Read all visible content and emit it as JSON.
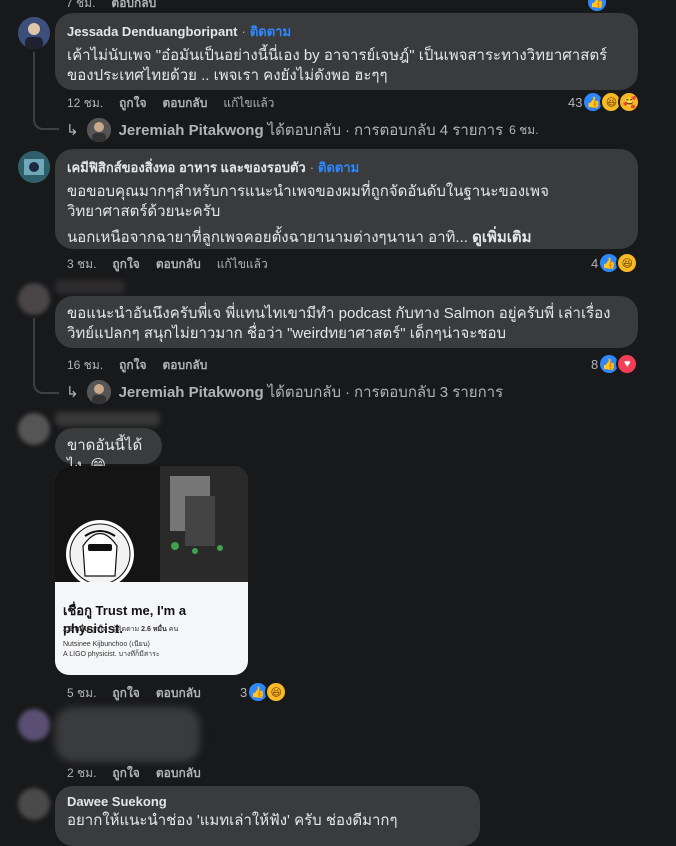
{
  "colors": {
    "background": "#18191a",
    "bubble": "#3a3b3c",
    "link": "#2d88ff",
    "muted": "#b0b3b8"
  },
  "top_partial": {
    "time": "7 ชม.",
    "reply": "ตอบกลับ"
  },
  "comments": [
    {
      "name": "Jessada Denduangboripant",
      "follow": "ติดตาม",
      "text": "เค้าไม่นับเพจ \"อ๋อมันเป็นอย่างนี้นี่เอง by อาจารย์เจษฎ์\" เป็นเพจสาระทางวิทยาศาสตร์ของประเทศไทยด้วย .. เพจเรา คงยังไม่ดังพอ ฮะๆๆ",
      "time": "12 ชม.",
      "like": "ถูกใจ",
      "reply": "ตอบกลับ",
      "edited": "แก้ไขแล้ว",
      "reaction_count": "43",
      "reaction_icons": [
        "like-icon",
        "haha-icon",
        "care-icon"
      ],
      "replies": {
        "name": "Jeremiah Pitakwong",
        "replied": "ได้ตอบกลับ",
        "count": "การตอบกลับ 4 รายการ",
        "time": "6 ชม."
      }
    },
    {
      "name": "เคมีฟิสิกส์ของสิ่งทอ อาหาร และของรอบตัว",
      "follow": "ติดตาม",
      "text": "ขอขอบคุณมากๆสำหรับการแนะนำเพจของผมที่ถูกจัดอันดับในฐานะของเพจวิทยาศาสตร์ด้วยนะครับ",
      "text2": "นอกเหนือจากฉายาที่ลูกเพจคอยตั้งฉายานามต่างๆนานา อาทิ...",
      "seemore": "ดูเพิ่มเติม",
      "time": "3 ชม.",
      "like": "ถูกใจ",
      "reply": "ตอบกลับ",
      "edited": "แก้ไขแล้ว",
      "reaction_count": "4",
      "reaction_icons": [
        "like-icon",
        "haha-icon"
      ]
    },
    {
      "text": "ขอแนะนำอันนึงครับพี่เจ พี่แทนไทเขามีทำ podcast กับทาง Salmon อยู่ครับพี่ เล่าเรื่องวิทย์แปลกๆ สนุกไม่ยาวมาก ชื่อว่า \"weirdทยาศาสตร์\" เด็กๆน่าจะชอบ",
      "time": "16 ชม.",
      "like": "ถูกใจ",
      "reply": "ตอบกลับ",
      "reaction_count": "8",
      "reaction_icons": [
        "like-icon",
        "love-icon"
      ],
      "replies": {
        "name": "Jeremiah Pitakwong",
        "replied": "ได้ตอบกลับ",
        "count": "การตอบกลับ 3 รายการ"
      }
    },
    {
      "text": "ขาดอันนี้ได้ไง",
      "emoji": "😁",
      "card": {
        "title": "เชื่อกู Trust me, I'm a physicist.",
        "likes_num": "2.5 หมื่น",
        "likes_label": "ถูกใจ",
        "followers_label": "ผู้ติดตาม",
        "followers_num": "2.6 หมื่น",
        "followers_unit": "คน",
        "line1": "Nutsinee Kijbunchoo (เนียน)",
        "line2": "A LIGO physicist. บางทีก็มีสาระ"
      },
      "time": "5 ชม.",
      "like": "ถูกใจ",
      "reply": "ตอบกลับ",
      "reaction_count": "3",
      "reaction_icons": [
        "like-icon",
        "haha-icon"
      ]
    },
    {
      "time": "2 ชม.",
      "like": "ถูกใจ",
      "reply": "ตอบกลับ"
    },
    {
      "name": "Dawee Suekong",
      "text": "อยากให้แนะนำช่อง 'แมทเล่าให้ฟัง' ครับ ช่องดีมากๆ"
    }
  ]
}
